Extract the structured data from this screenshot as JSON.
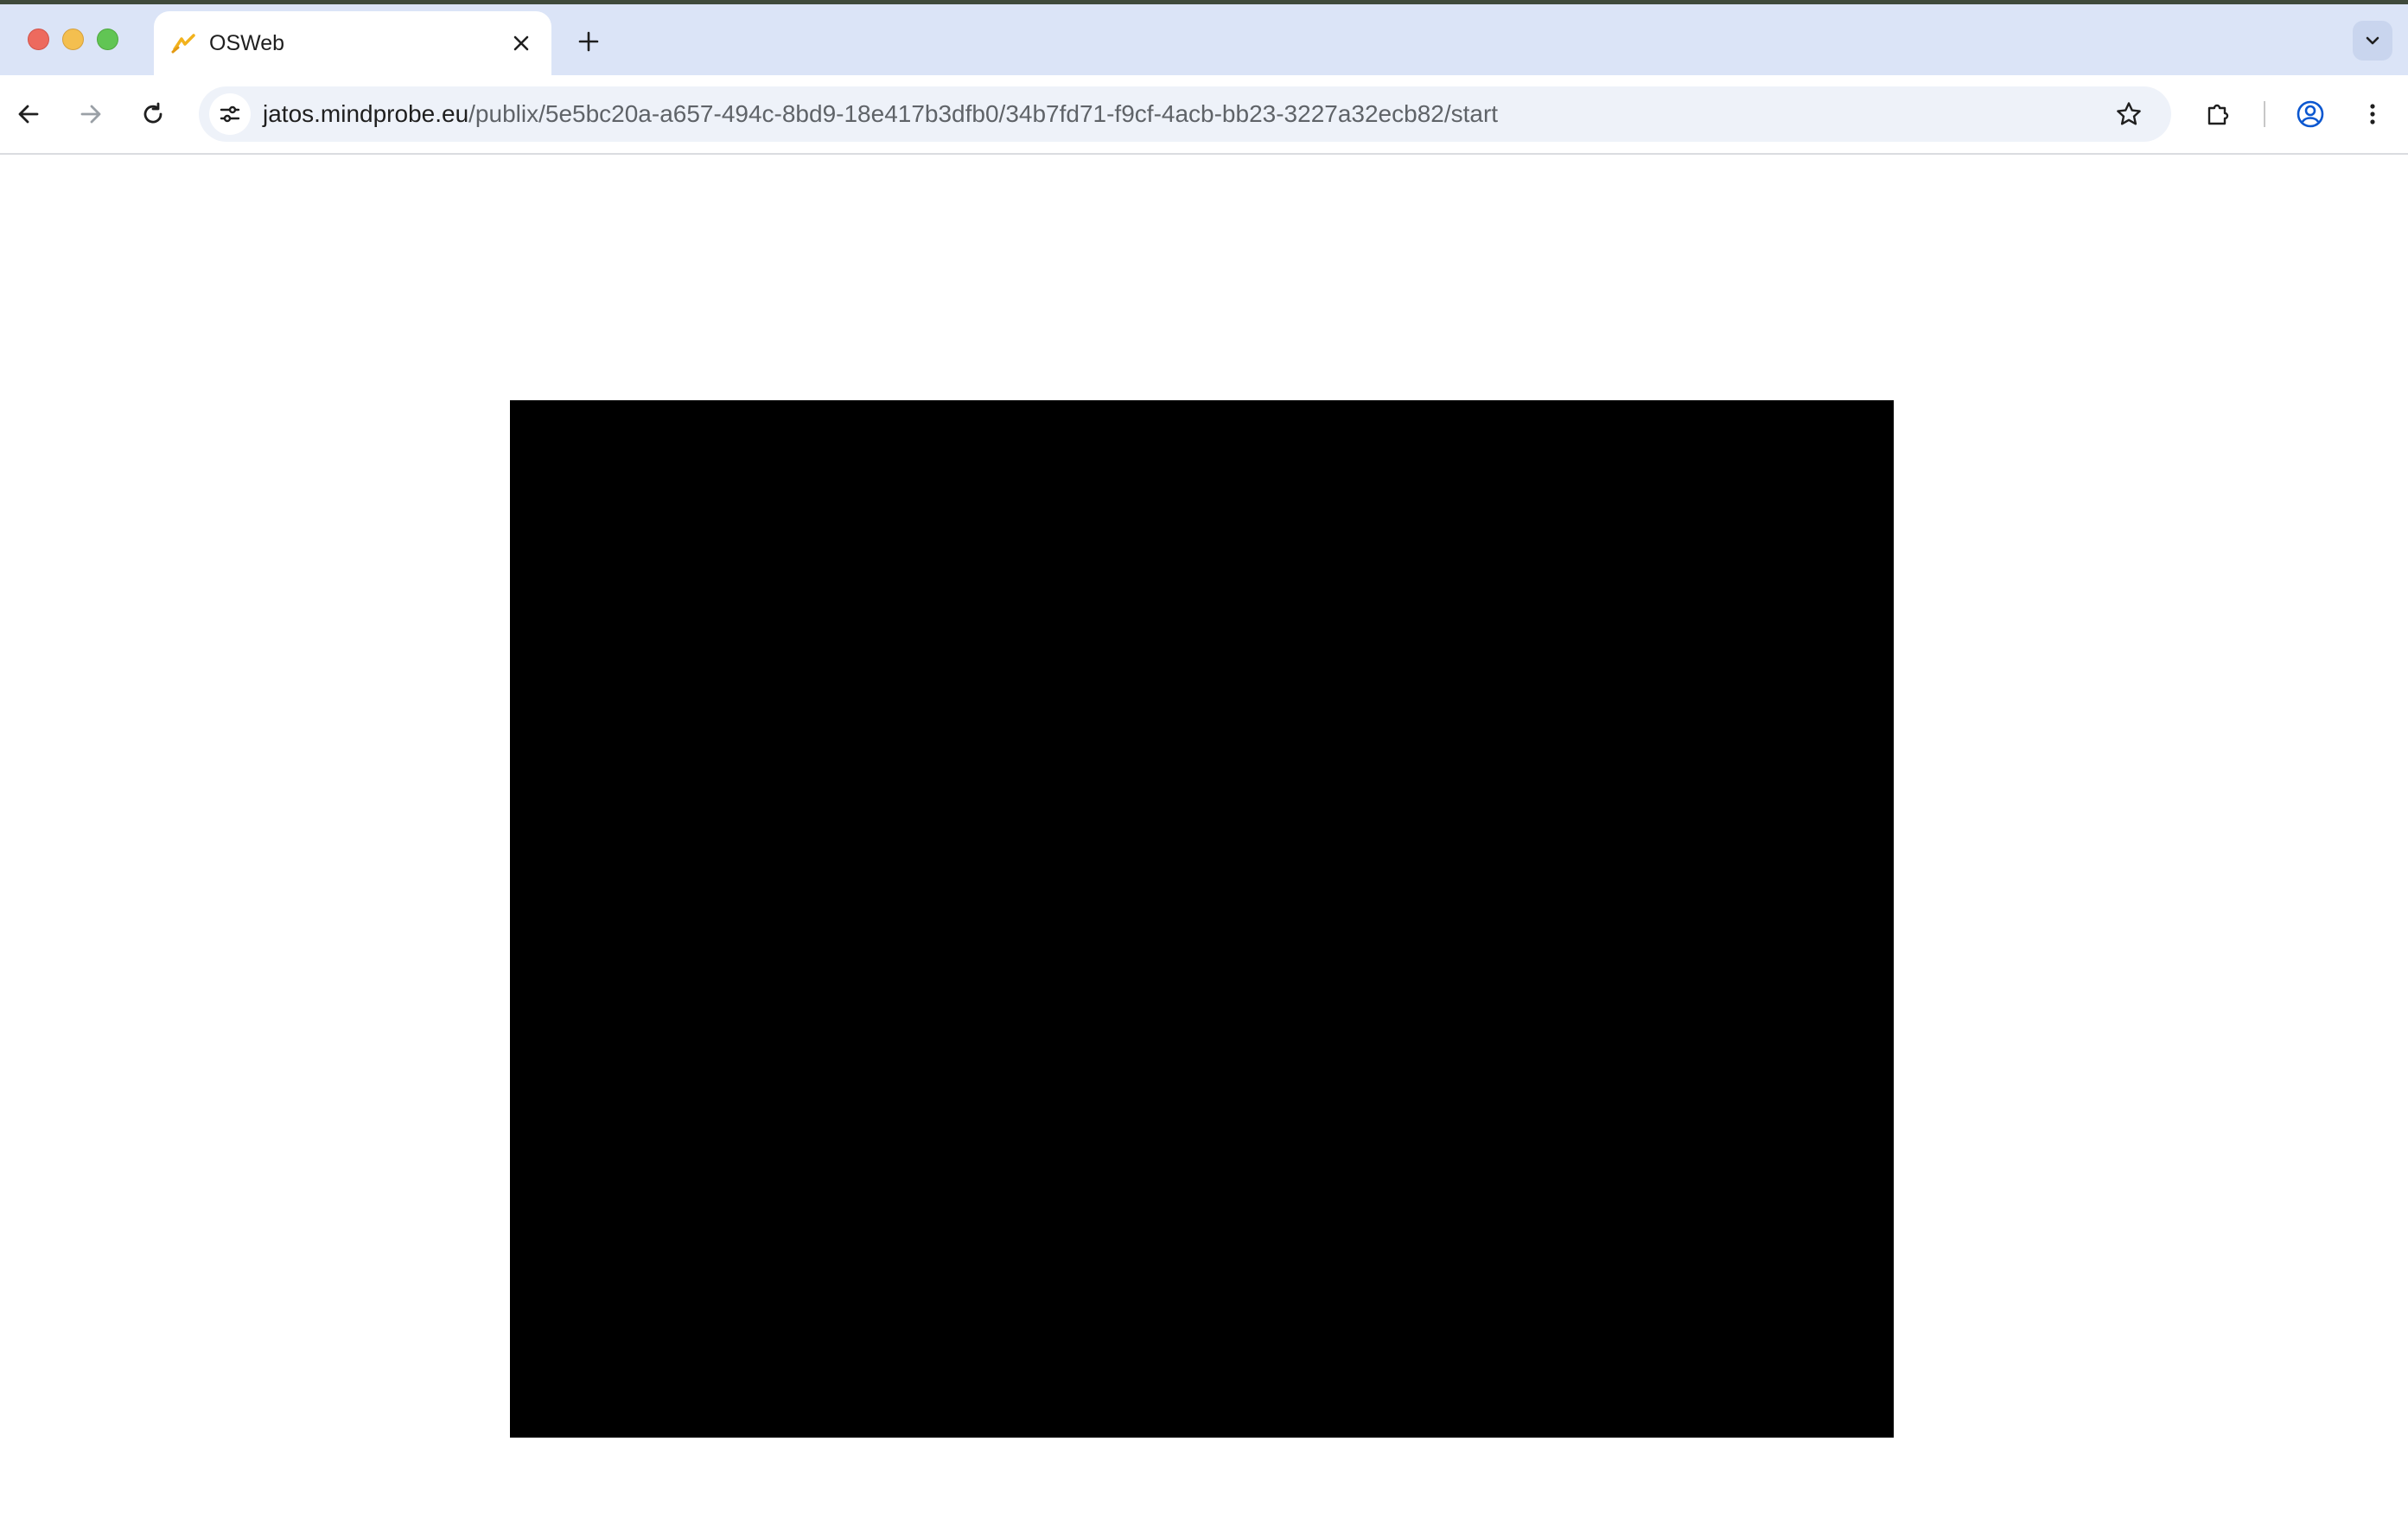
{
  "tab": {
    "title": "OSWeb",
    "favicon": "osweb-logo-icon"
  },
  "toolbar": {
    "url_host": "jatos.mindprobe.eu",
    "url_path": "/publix/5e5bc20a-a657-494c-8bd9-18e417b3dfb0/34b7fd71-f9cf-4acb-bb23-3227a32ecb82/start"
  },
  "colors": {
    "tabstrip": "#dbe4f7",
    "canvas": "#000000",
    "profile_accent": "#0b57d0"
  }
}
